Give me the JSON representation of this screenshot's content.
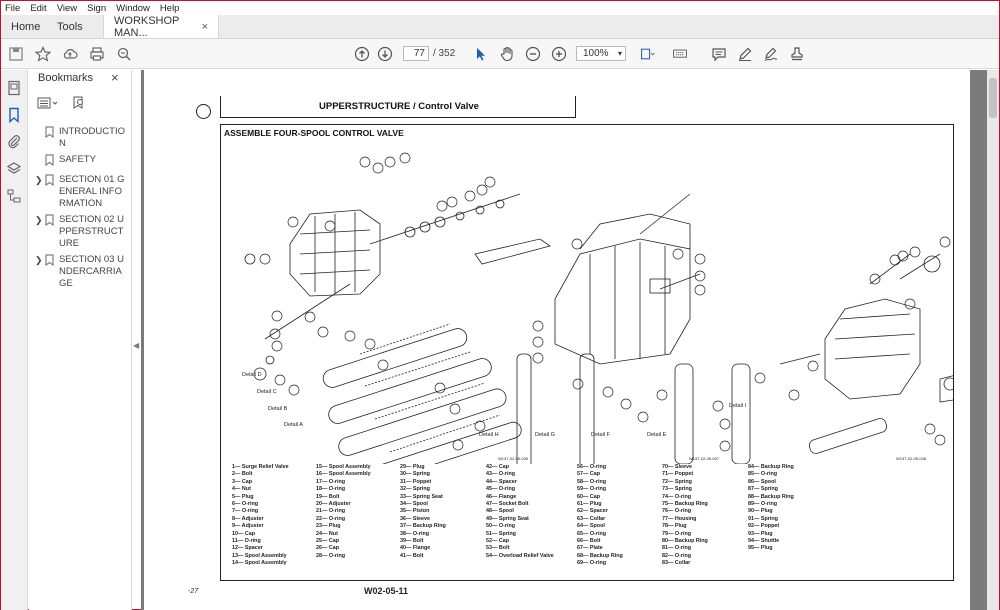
{
  "menu": [
    "File",
    "Edit",
    "View",
    "Sign",
    "Window",
    "Help"
  ],
  "tabs": {
    "home": "Home",
    "tools": "Tools",
    "doc": "WORKSHOP MAN...",
    "doc_close": "×"
  },
  "toolbar": {
    "page_current": "77",
    "page_total": "/ 352",
    "zoom": "100%"
  },
  "bookmarks": {
    "title": "Bookmarks",
    "close": "×",
    "items": [
      {
        "label": "INTRODUCTION",
        "expandable": false
      },
      {
        "label": "SAFETY",
        "expandable": false
      },
      {
        "label": "SECTION 01 GENERAL INFORMATION",
        "expandable": true
      },
      {
        "label": "SECTION 02 UPPERSTRUCTURE",
        "expandable": true
      },
      {
        "label": "SECTION 03 UNDERCARRIAGE",
        "expandable": true
      }
    ]
  },
  "page": {
    "header": "UPPERSTRUCTURE / Control Valve",
    "section_title": "ASSEMBLE FOUR-SPOOL CONTROL VALVE",
    "details": [
      "Detail A",
      "Detail B",
      "Detail C",
      "Detail D",
      "Detail E",
      "Detail F",
      "Detail G",
      "Detail H",
      "Detail I"
    ],
    "figure_ids": [
      "W137-02-05-006",
      "W137-02-05-007",
      "W137-02-05-008"
    ],
    "footer": "W02-05-11",
    "footer_left": "-27"
  },
  "legend": [
    [
      "1— Surge Relief Valve",
      "2— Bolt",
      "3— Cap",
      "4— Nut",
      "5— Plug",
      "6— O-ring",
      "7— O-ring",
      "8— Adjuster",
      "9— Adjuster",
      "10— Cap",
      "11— O-ring",
      "12— Spacer",
      "13— Spool Assembly",
      "14— Spool Assembly"
    ],
    [
      "15— Spool Assembly",
      "16— Spool Assembly",
      "17— O-ring",
      "18— O-ring",
      "19— Bolt",
      "20— Adjuster",
      "21— O-ring",
      "22— O-ring",
      "23— Plug",
      "24— Nut",
      "25— Cap",
      "26— Cap",
      "28— O-ring"
    ],
    [
      "29— Plug",
      "30— Spring",
      "31— Poppet",
      "32— Spring",
      "33— Spring Seat",
      "34— Spool",
      "35— Piston",
      "36— Sleeve",
      "37— Backup Ring",
      "38— O-ring",
      "39— Bolt",
      "40— Flange",
      "41— Bolt"
    ],
    [
      "42— Cap",
      "43— O-ring",
      "44— Spacer",
      "45— O-ring",
      "46— Flange",
      "47— Socket Bolt",
      "48— Spool",
      "49— Spring Seat",
      "50— O-ring",
      "51— Spring",
      "52— Cap",
      "53— Bolt",
      "54— Overload Relief Valve"
    ],
    [
      "56— O-ring",
      "57— Cap",
      "58— O-ring",
      "59— O-ring",
      "60— Cap",
      "61— Plug",
      "62— Spacer",
      "63— Collar",
      "64— Spool",
      "65— O-ring",
      "66— Bolt",
      "67— Plate",
      "68— Backup Ring",
      "69— O-ring"
    ],
    [
      "70— Sleeve",
      "71— Poppet",
      "72— Spring",
      "73— Spring",
      "74— O-ring",
      "75— Backup Ring",
      "76— O-ring",
      "77— Housing",
      "78— Plug",
      "79— O-ring",
      "80— Backup Ring",
      "81— O-ring",
      "82— O-ring",
      "83— Collar"
    ],
    [
      "84— Backup Ring",
      "85— O-ring",
      "86— Spool",
      "87— Spring",
      "88— Backup Ring",
      "89— O-ring",
      "90— Plug",
      "91— Spring",
      "92— Poppet",
      "93— Plug",
      "94— Shuttle",
      "95— Plug"
    ]
  ]
}
